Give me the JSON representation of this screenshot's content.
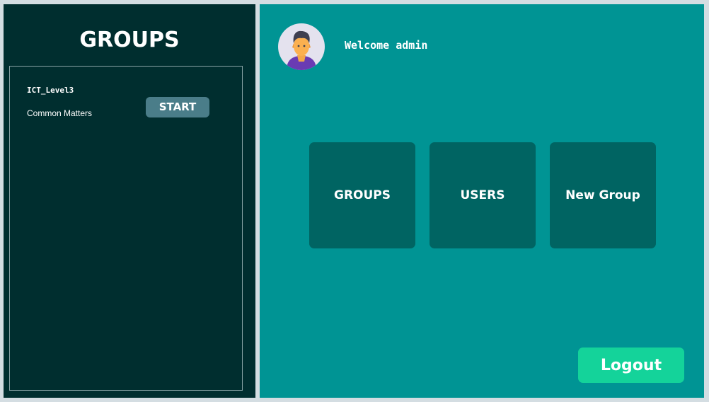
{
  "sidebar": {
    "title": "GROUPS",
    "groups": [
      {
        "name": "ICT_Level3",
        "description": "Common Matters",
        "start_label": "START"
      }
    ]
  },
  "header": {
    "welcome": "Welcome admin",
    "avatar_icon": "user-avatar-icon"
  },
  "tiles": {
    "groups_label": "GROUPS",
    "users_label": "USERS",
    "new_group_label": "New Group"
  },
  "logout_label": "Logout",
  "colors": {
    "background": "#d4dde2",
    "sidebar_bg": "#002e2f",
    "main_bg": "#009494",
    "tile_bg": "#006462",
    "start_button": "#4a7d89",
    "logout_button": "#14d39a",
    "text": "#ffffff"
  }
}
